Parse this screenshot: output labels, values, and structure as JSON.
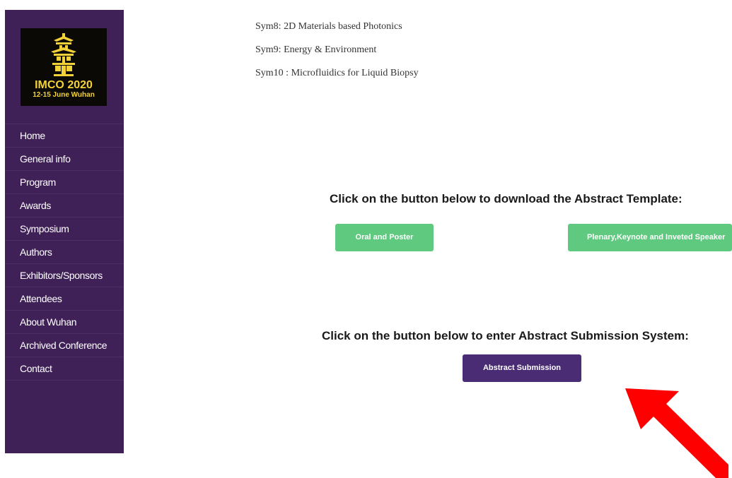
{
  "logo": {
    "title": "IMCO 2020",
    "subtitle": "12-15 June  Wuhan",
    "emblem_icon": "pagoda-emblem-icon"
  },
  "nav": {
    "items": [
      {
        "label": "Home"
      },
      {
        "label": "General info"
      },
      {
        "label": "Program"
      },
      {
        "label": "Awards"
      },
      {
        "label": "Symposium"
      },
      {
        "label": "Authors"
      },
      {
        "label": "Exhibitors/Sponsors"
      },
      {
        "label": "Attendees"
      },
      {
        "label": "About Wuhan"
      },
      {
        "label": "Archived Conference"
      },
      {
        "label": "Contact"
      }
    ]
  },
  "symposia": [
    "Sym8: 2D Materials based Photonics",
    "Sym9: Energy & Environment",
    "Sym10 : Microfluidics for Liquid Biopsy"
  ],
  "template_section": {
    "heading": "Click on the button below to download the Abstract Template:",
    "oral_poster_label": "Oral and Poster",
    "plenary_label": "Plenary,Keynote and Inveted Speaker"
  },
  "submission_section": {
    "heading": "Click on the button below to enter Abstract Submission System:",
    "submit_label": "Abstract Submission"
  },
  "annotation": {
    "arrow_icon": "red-arrow-icon",
    "arrow_color": "#ff0000"
  },
  "colors": {
    "sidebar": "#3f2158",
    "green_button": "#5fc97f",
    "purple_button": "#4a2c75",
    "logo_gold": "#f3d238"
  }
}
